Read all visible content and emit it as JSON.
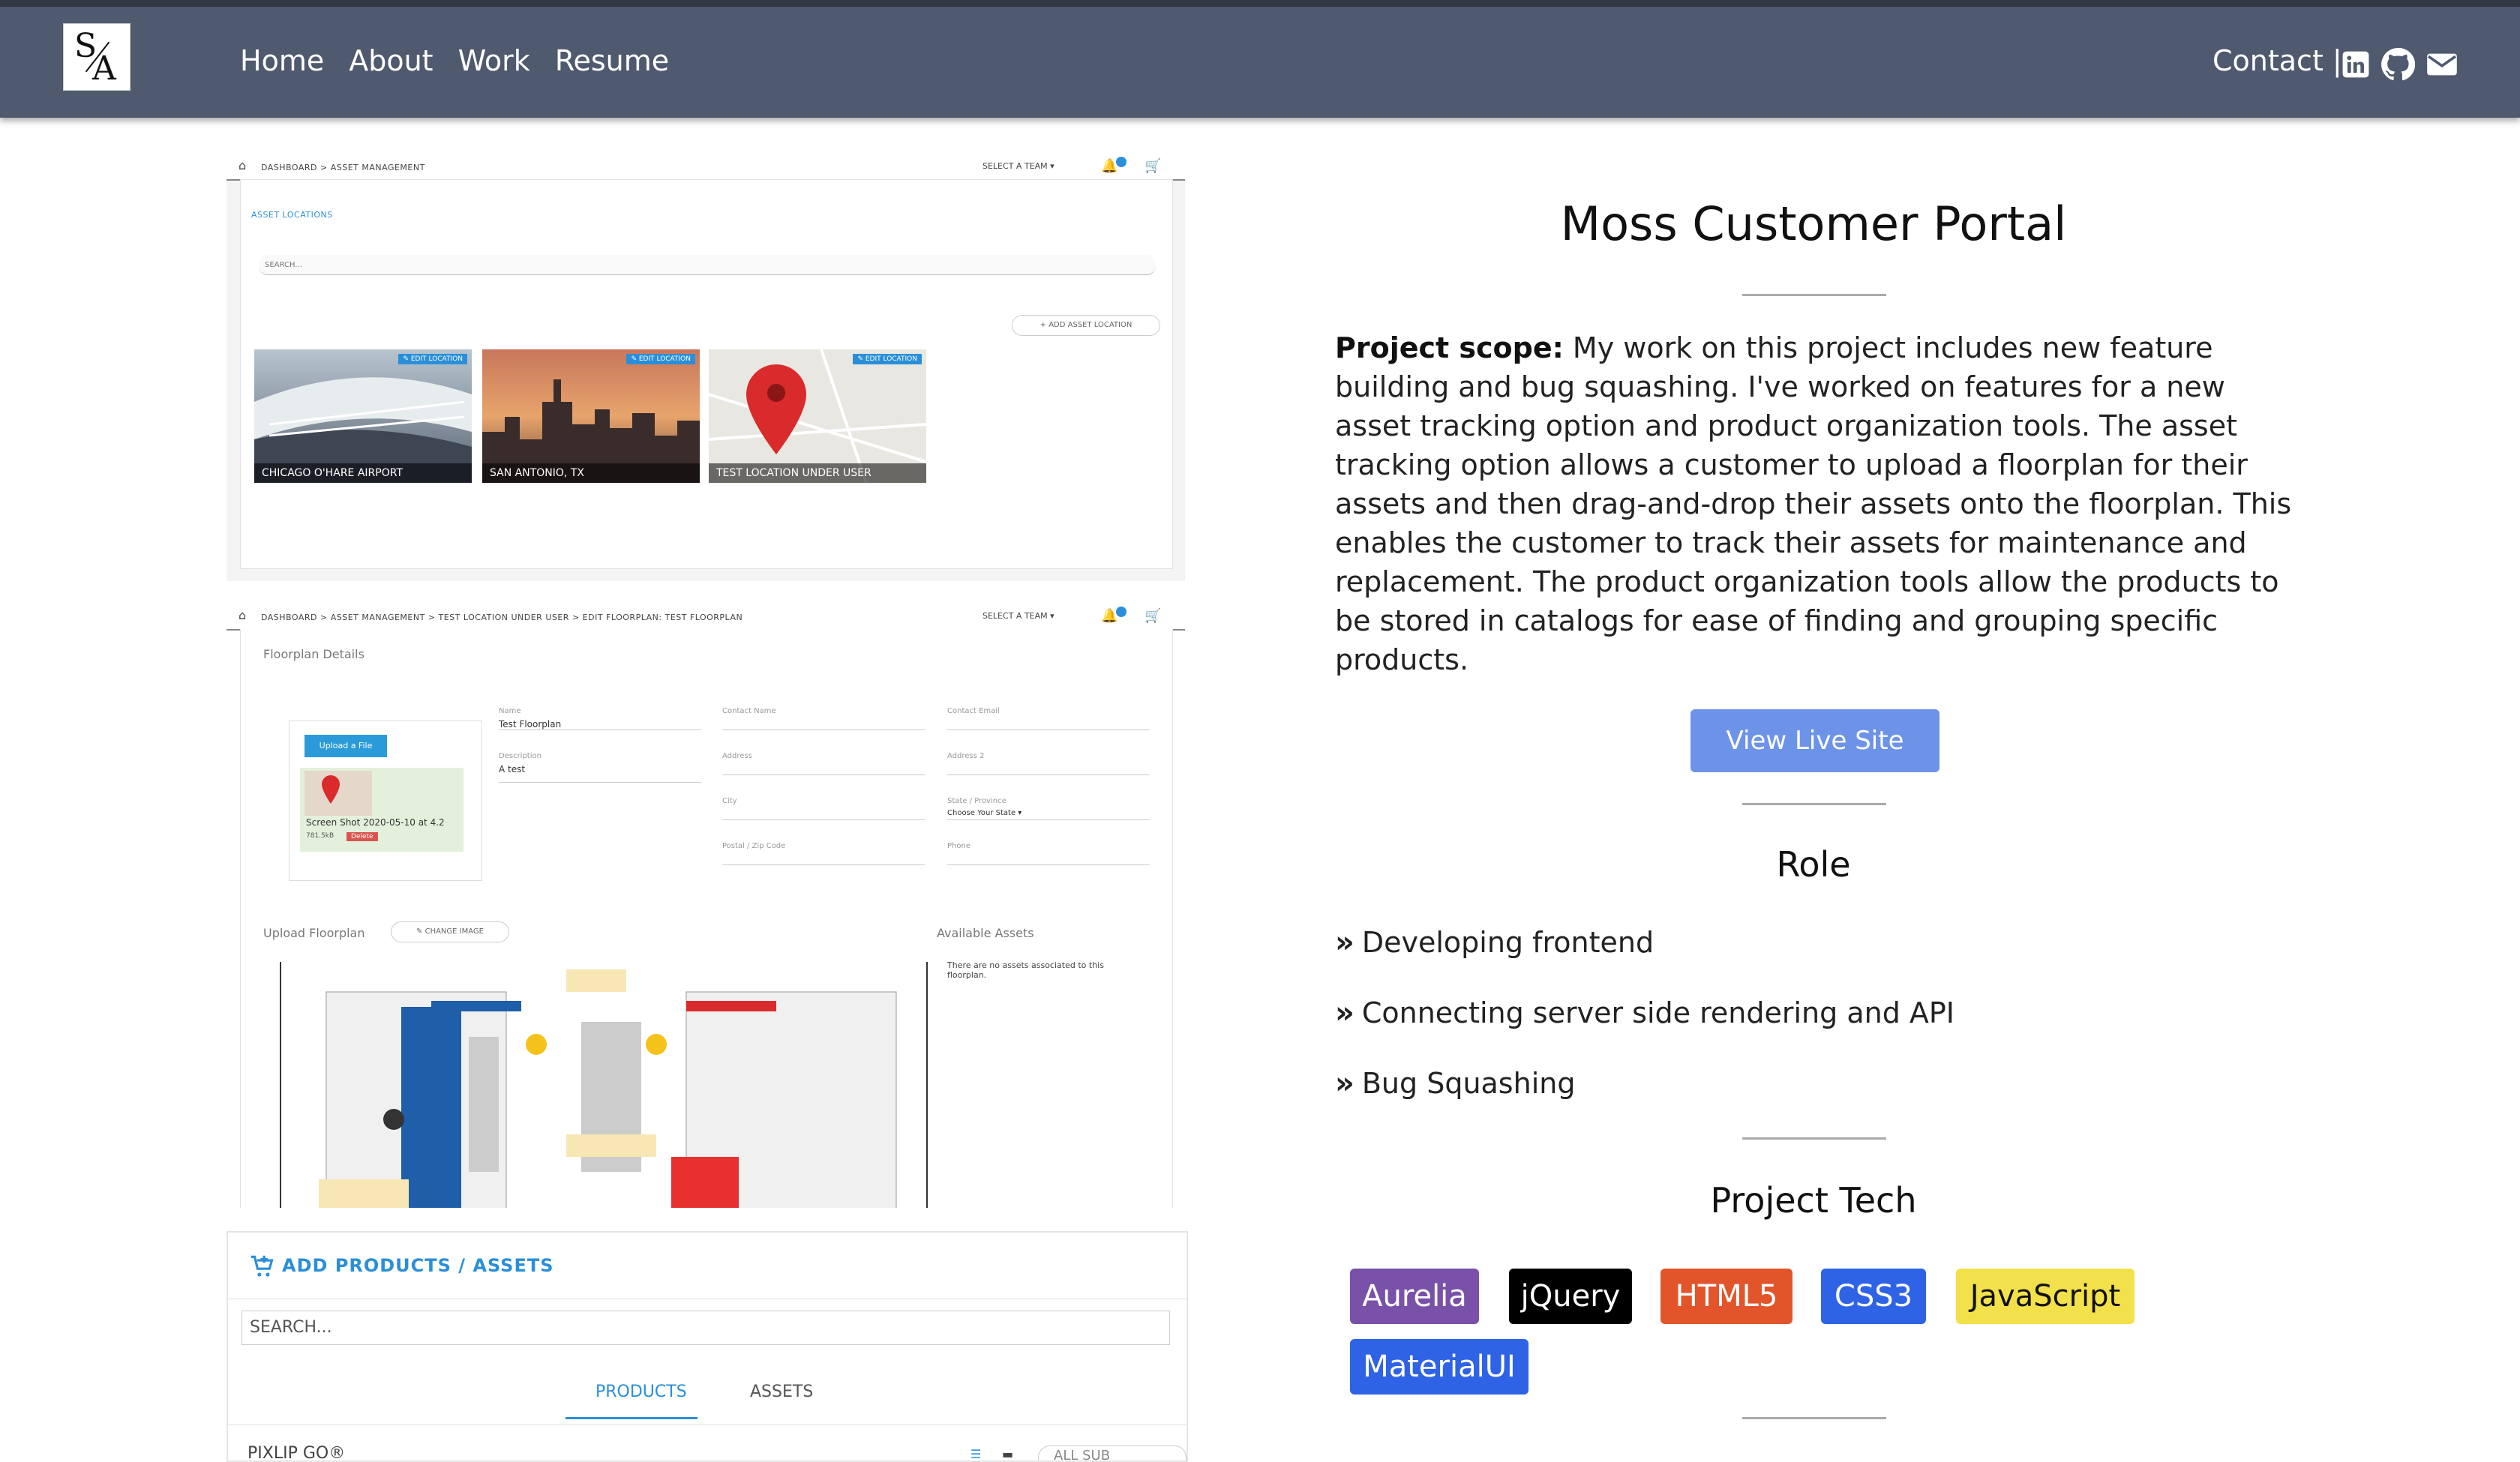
{
  "nav": {
    "logo_top": "S",
    "logo_bottom": "A",
    "links": [
      "Home",
      "About",
      "Work",
      "Resume"
    ],
    "contact_label": "Contact |",
    "social_icons": [
      "linkedin-icon",
      "github-icon",
      "mail-icon"
    ]
  },
  "project": {
    "title": "Moss Customer Portal",
    "scope_label": "Project scope:",
    "scope_text": " My work on this project includes new feature building and bug squashing. I've worked on features for a new asset tracking option and product organization tools. The asset tracking option allows a customer to upload a floorplan for their assets and then drag-and-drop their assets onto the floorplan. This enables the customer to track their assets for maintenance and replacement. The product organization tools allow the products to be stored in catalogs for ease of finding and grouping specific products.",
    "live_button": "View Live Site",
    "role_heading": "Role",
    "roles": [
      "Developing frontend",
      "Connecting server side rendering and API",
      "Bug Squashing"
    ],
    "tech_heading": "Project Tech",
    "tech": [
      {
        "label": "Aurelia",
        "color": "#7951a8"
      },
      {
        "label": "jQuery",
        "color": "#000000"
      },
      {
        "label": "HTML5",
        "color": "#e2552b"
      },
      {
        "label": "CSS3",
        "color": "#2f63e6"
      },
      {
        "label": "JavaScript",
        "color": "#f2e14a"
      },
      {
        "label": "MaterialUI",
        "color": "#2f63e6"
      }
    ]
  },
  "shot1": {
    "breadcrumb": "DASHBOARD  >  ASSET MANAGEMENT",
    "team": "SELECT A TEAM ▾",
    "section": "ASSET LOCATIONS",
    "search": "SEARCH...",
    "add_location": "+  ADD ASSET LOCATION",
    "edit_label": "✎ EDIT LOCATION",
    "cards": [
      "CHICAGO O'HARE AIRPORT",
      "SAN ANTONIO, TX",
      "TEST LOCATION UNDER USER"
    ]
  },
  "shot2": {
    "breadcrumb": "DASHBOARD  >  ASSET MANAGEMENT  >  TEST LOCATION UNDER USER  >  EDIT FLOORPLAN: TEST FLOORPLAN",
    "team": "SELECT A TEAM ▾",
    "section": "Floorplan Details",
    "upload_btn": "Upload a File",
    "file_name": "Screen Shot 2020-05-10 at 4.2",
    "file_size": "781.5kB",
    "delete": "Delete",
    "name_label": "Name",
    "name_value": "Test Floorplan",
    "desc_label": "Description",
    "desc_value": "A test",
    "contact_name": "Contact Name",
    "contact_email": "Contact Email",
    "address": "Address",
    "address2": "Address 2",
    "city": "City",
    "state_label": "State / Province",
    "state_value": "Choose Your State ▾",
    "postal": "Postal / Zip Code",
    "phone": "Phone",
    "upload_floorplan": "Upload Floorplan",
    "change_image": "✎  CHANGE IMAGE",
    "available_assets": "Available Assets",
    "no_assets": "There are no assets associated to this floorplan."
  },
  "shot3": {
    "header": "ADD PRODUCTS / ASSETS",
    "search": "SEARCH...",
    "tabs": [
      "PRODUCTS",
      "ASSETS"
    ],
    "first_row": "PIXLIP GO®",
    "catalogs": "ALL SUB CATALOGS"
  }
}
